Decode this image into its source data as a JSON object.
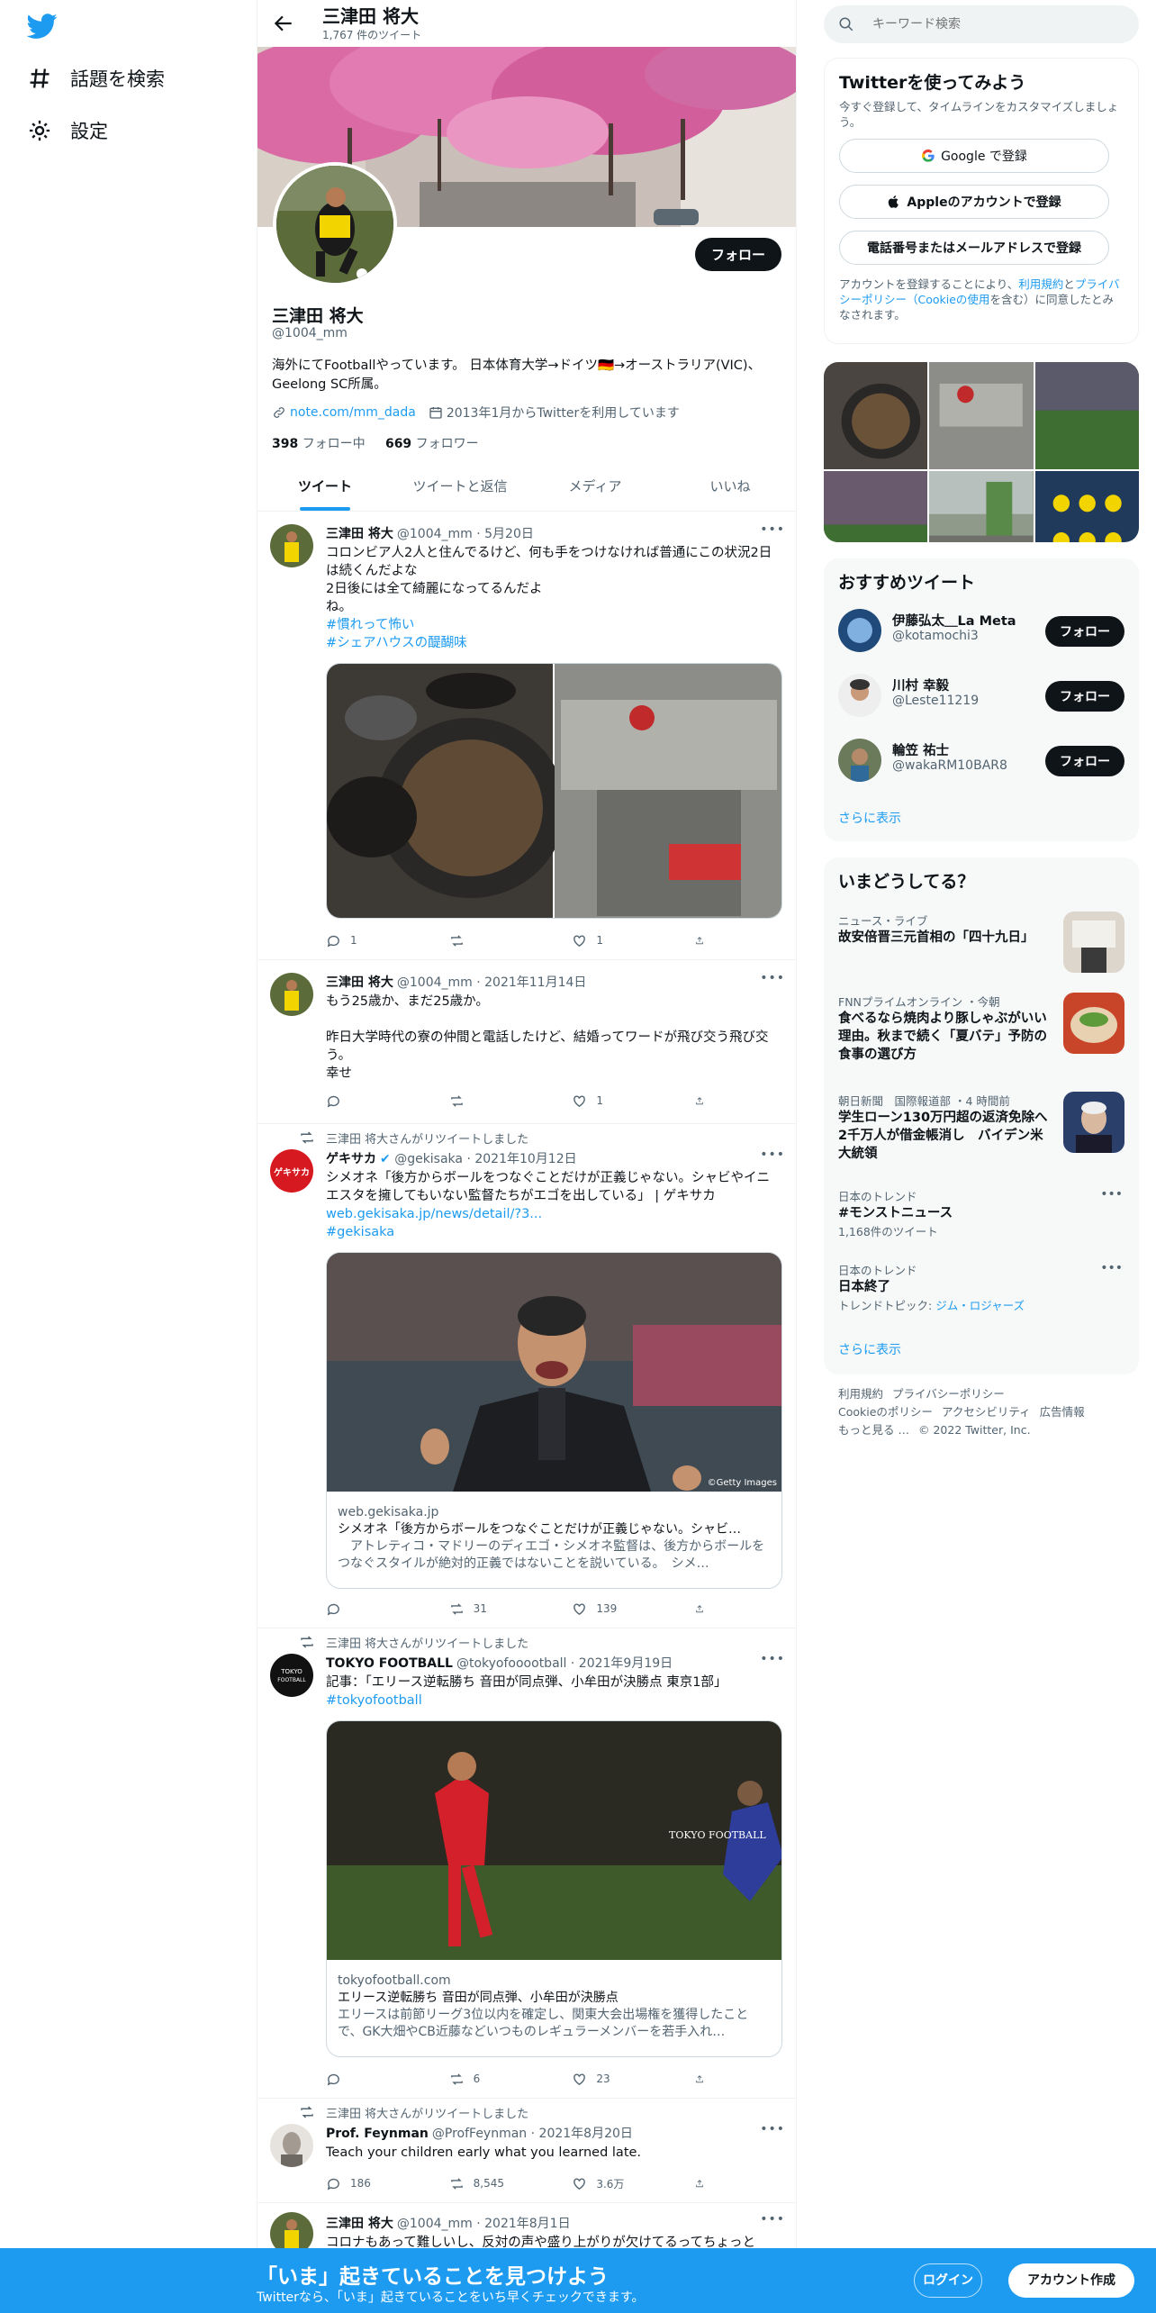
{
  "nav": {
    "explore_label": "話題を検索",
    "settings_label": "設定"
  },
  "header": {
    "title": "三津田 将大",
    "tweet_count": "1,767 件のツイート"
  },
  "profile": {
    "name": "三津田 将大",
    "handle": "@1004_mm",
    "follow_label": "フォロー",
    "bio": "海外にてFootballやっています。 日本体育大学→ドイツ🇩🇪→オーストラリア(VIC)、Geelong SC所属。",
    "link": "note.com/mm_dada",
    "joined": "2013年1月からTwitterを利用しています",
    "following_count": "398",
    "following_label": "フォロー中",
    "followers_count": "669",
    "followers_label": "フォロワー"
  },
  "tabs": [
    "ツイート",
    "ツイートと返信",
    "メディア",
    "いいね"
  ],
  "tweets": [
    {
      "name": "三津田 将大",
      "handle": "@1004_mm",
      "date": "5月20日",
      "text": "コロンビア人2人と住んでるけど、何も手をつけなければ普通にこの状況2日は続くんだよな\n2日後には全て綺麗になってるんだよ\nね。",
      "tags": [
        "#慣れって怖い",
        "#シェアハウスの醍醐味"
      ],
      "reply": "1",
      "retweet": "",
      "like": "1"
    },
    {
      "name": "三津田 将大",
      "handle": "@1004_mm",
      "date": "2021年11月14日",
      "text": "もう25歳か、まだ25歳か。\n\n昨日大学時代の寮の仲間と電話したけど、結婚ってワードが飛び交う飛び交う。\n幸せ",
      "reply": "",
      "retweet": "",
      "like": "1"
    },
    {
      "retweeted_by": "三津田 将大さんがリツイートしました",
      "name": "ゲキサカ",
      "handle": "@gekisaka",
      "date": "2021年10月12日",
      "text": "シメオネ「後方からボールをつなぐことだけが正義じゃない。シャビやイニエスタを擁してもいない監督たちがエゴを出している」 | ゲキサカ",
      "link": "web.gekisaka.jp/news/detail/?3...",
      "tag": "#gekisaka",
      "card_site": "web.gekisaka.jp",
      "card_title": "シメオネ「後方からボールをつなぐことだけが正義じゃない。シャビ…",
      "card_desc": "　アトレティコ・マドリーのディエゴ・シメオネ監督は、後方からボールをつなぐスタイルが絶対的正義ではないことを説いている。　シメ…",
      "image_credit": "©Getty Images",
      "reply": "",
      "retweet": "31",
      "like": "139"
    },
    {
      "retweeted_by": "三津田 将大さんがリツイートしました",
      "name": "TOKYO FOOTBALL",
      "handle": "@tokyofooootball",
      "date": "2021年9月19日",
      "text": "記事：「エリース逆転勝ち 音田が同点弾、小牟田が決勝点 東京1部」",
      "tag": "#tokyofootball",
      "card_site": "tokyofootball.com",
      "card_title": "エリース逆転勝ち 音田が同点弾、小牟田が決勝点",
      "card_desc": "エリースは前節リーグ3位以内を確定し、関東大会出場権を獲得したことで、GK大畑やCB近藤などいつものレギュラーメンバーを若手入れ…",
      "image_logo": "TOKYO FOOTBALL",
      "reply": "",
      "retweet": "6",
      "like": "23"
    },
    {
      "retweeted_by": "三津田 将大さんがリツイートしました",
      "name": "Prof. Feynman",
      "handle": "@ProfFeynman",
      "date": "2021年8月20日",
      "text": "Teach your children early what you learned late.",
      "reply": "186",
      "retweet": "8,545",
      "like": "3.6万"
    },
    {
      "name": "三津田 将大",
      "handle": "@1004_mm",
      "date": "2021年8月1日",
      "text": "コロナもあって難しいし、反対の声や盛り上がりが欠けてるってちょっと"
    }
  ],
  "right": {
    "search_placeholder": "キーワード検索",
    "signup": {
      "title": "Twitterを使ってみよう",
      "sub": "今すぐ登録して、タイムラインをカスタマイズしましょう。",
      "google": "Google で登録",
      "apple": "Appleのアカウントで登録",
      "phone": "電話番号またはメールアドレスで登録",
      "terms_pre": "アカウントを登録することにより、",
      "terms_link1": "利用規約",
      "terms_mid": "と",
      "terms_link2": "プライバシーポリシー（Cookieの使用",
      "terms_post": "を含む）に同意したとみなされます。"
    },
    "recommend": {
      "title": "おすすめツイート",
      "users": [
        {
          "name": "伊藤弘太＿La Meta",
          "handle": "@kotamochi3"
        },
        {
          "name": "川村 幸毅",
          "handle": "@Leste11219"
        },
        {
          "name": "輪笠 祐士",
          "handle": "@wakaRM10BAR8"
        }
      ],
      "follow_label": "フォロー",
      "more": "さらに表示"
    },
    "trends": {
      "title": "いまどうしてる？",
      "items": [
        {
          "cat": "ニュース・ライブ",
          "title": "故安倍晋三元首相の「四十九日」"
        },
        {
          "cat": "FNNプライムオンライン ・今朝",
          "title": "食べるなら焼肉より豚しゃぶがいい理由。秋まで続く「夏バテ」予防の食事の選び方"
        },
        {
          "cat": "朝日新聞　国際報道部 ・4 時間前",
          "title": "学生ローン130万円超の返済免除へ 2千万人が借金帳消し　バイデン米大統領"
        },
        {
          "cat": "日本のトレンド",
          "title": "#モンストニュース",
          "count": "1,168件のツイート"
        },
        {
          "cat": "日本のトレンド",
          "title": "日本終了",
          "count_pre": "トレンドトピック: ",
          "count_link": "ジム・ロジャーズ"
        }
      ],
      "more": "さらに表示"
    },
    "footer": {
      "terms": "利用規約",
      "privacy": "プライバシーポリシー",
      "cookie": "Cookieのポリシー",
      "a11y": "アクセシビリティ",
      "ads": "広告情報",
      "more": "もっと見る …",
      "copyright": "© 2022 Twitter, Inc."
    }
  },
  "bottom_bar": {
    "title": "「いま」起きていることを見つけよう",
    "sub": "Twitterなら、「いま」起きていることをいち早くチェックできます。",
    "login": "ログイン",
    "signup": "アカウント作成"
  }
}
